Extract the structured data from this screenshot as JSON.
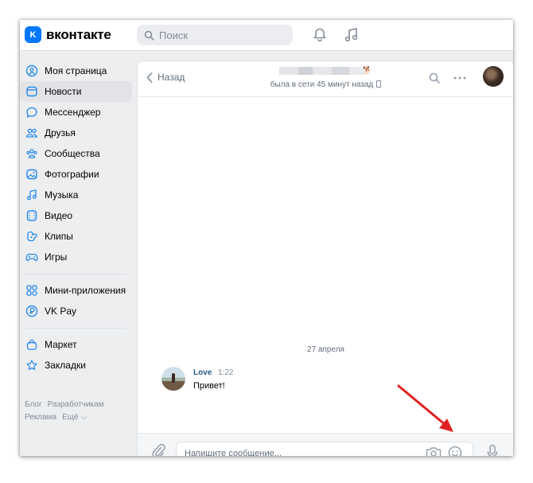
{
  "header": {
    "logo_letter": "K",
    "logo_text": "вконтакте",
    "search_placeholder": "Поиск",
    "icons": [
      "bell-icon",
      "music-icon"
    ]
  },
  "sidebar": {
    "items": [
      {
        "label": "Моя страница",
        "icon": "profile-icon"
      },
      {
        "label": "Новости",
        "icon": "news-icon",
        "active": true
      },
      {
        "label": "Мессенджер",
        "icon": "messenger-icon"
      },
      {
        "label": "Друзья",
        "icon": "friends-icon"
      },
      {
        "label": "Сообщества",
        "icon": "communities-icon"
      },
      {
        "label": "Фотографии",
        "icon": "photos-icon"
      },
      {
        "label": "Музыка",
        "icon": "music-icon"
      },
      {
        "label": "Видео",
        "icon": "video-icon"
      },
      {
        "label": "Клипы",
        "icon": "clips-icon"
      },
      {
        "label": "Игры",
        "icon": "games-icon"
      }
    ],
    "items2": [
      {
        "label": "Мини-приложения",
        "icon": "mini-apps-icon"
      },
      {
        "label": "VK Pay",
        "icon": "vkpay-icon"
      }
    ],
    "items3": [
      {
        "label": "Маркет",
        "icon": "market-icon"
      },
      {
        "label": "Закладки",
        "icon": "bookmarks-icon"
      }
    ],
    "footer": {
      "blog": "Блог",
      "developers": "Разработчикам",
      "ads": "Реклама",
      "more": "Ещё ⌵"
    }
  },
  "chat": {
    "back_label": "Назад",
    "peer_status": "была в сети 45 минут назад",
    "date_separator": "27 апреля",
    "message": {
      "author": "Love",
      "time": "1:22",
      "text": "Привет!"
    },
    "composer_placeholder": "Напишите сообщение..."
  },
  "colors": {
    "accent": "#0077ff",
    "link": "#2a5885",
    "page_bg": "#edeef0",
    "arrow": "#e02020"
  }
}
